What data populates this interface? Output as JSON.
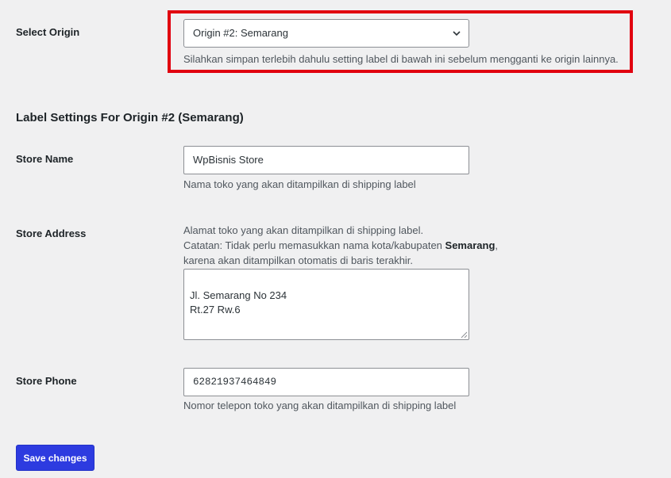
{
  "origin": {
    "label": "Select Origin",
    "selected": "Origin #2: Semarang",
    "note": "Silahkan simpan terlebih dahulu setting label di bawah ini sebelum mengganti ke origin lainnya."
  },
  "section": {
    "title": "Label Settings For Origin #2 (Semarang)"
  },
  "store_name": {
    "label": "Store Name",
    "value": "WpBisnis Store",
    "desc": "Nama toko yang akan ditampilkan di shipping label"
  },
  "store_address": {
    "label": "Store Address",
    "desc_line1": "Alamat toko yang akan ditampilkan di shipping label.",
    "desc_line2_prefix": "Catatan: Tidak perlu memasukkan nama kota/kabupaten ",
    "desc_line2_city": "Semarang",
    "desc_line2_suffix": ",",
    "desc_line3": "karena akan ditampilkan otomatis di baris terakhir.",
    "value": "Jl. Semarang No 234\nRt.27 Rw.6"
  },
  "store_phone": {
    "label": "Store Phone",
    "value": "62821937464849",
    "desc": "Nomor telepon toko yang akan ditampilkan di shipping label"
  },
  "actions": {
    "save_label": "Save changes"
  },
  "colors": {
    "highlight": "#e1000f",
    "primary_button": "#2d3be0",
    "background": "#f0f0f1"
  }
}
